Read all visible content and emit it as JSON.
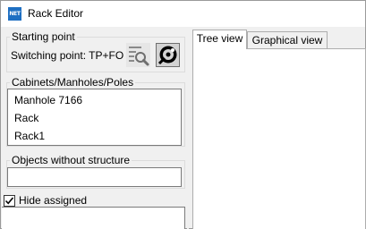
{
  "window": {
    "title": "Rack Editor",
    "icon_text": "NET"
  },
  "starting_point": {
    "legend": "Starting point",
    "label": "Switching point: TP+FO",
    "search_button_icon": "search-list-icon",
    "net_button_icon": "network-pick-icon"
  },
  "cabinets": {
    "legend": "Cabinets/Manholes/Poles",
    "items": [
      "Manhole 7166",
      "Rack",
      "Rack1"
    ]
  },
  "objects": {
    "legend": "Objects without structure",
    "value": ""
  },
  "hide_assigned": {
    "label": "Hide assigned",
    "checked": true
  },
  "tabs": [
    {
      "label": "Tree view",
      "active": true
    },
    {
      "label": "Graphical view",
      "active": false
    }
  ]
}
